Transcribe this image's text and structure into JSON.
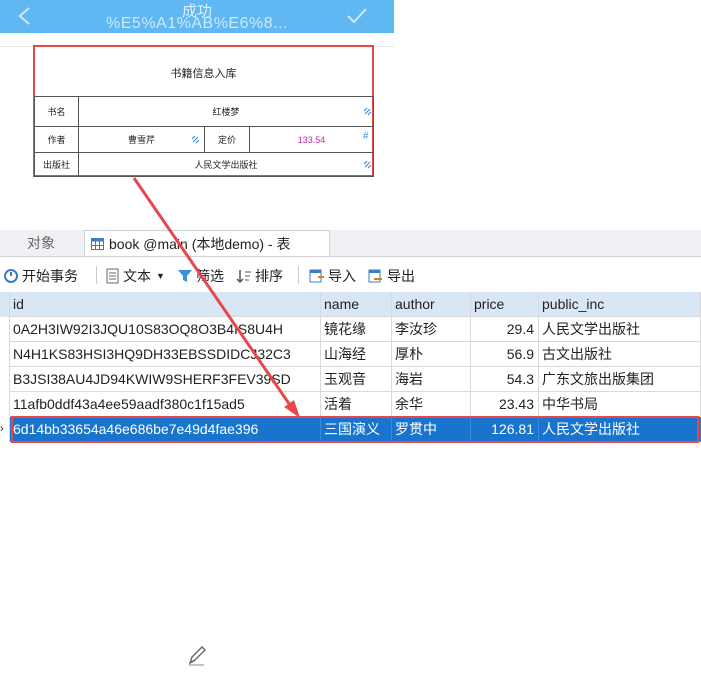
{
  "mobile": {
    "title": "成功",
    "url_text": "%E5%A1%AB%E6%8...",
    "form": {
      "title": "书籍信息入库",
      "name_label": "书名",
      "name_value": "红楼梦",
      "author_label": "作者",
      "author_value": "曹雪芹",
      "price_label": "定价",
      "price_value": "133.54",
      "publisher_label": "出版社",
      "publisher_value": "人民文学出版社"
    }
  },
  "db": {
    "tabs": [
      {
        "label": "对象"
      },
      {
        "label": "book @main (本地demo) - 表"
      }
    ],
    "toolbar": {
      "begin_tx": "开始事务",
      "text": "文本",
      "filter": "筛选",
      "sort": "排序",
      "import": "导入",
      "export": "导出"
    },
    "columns": [
      "id",
      "name",
      "author",
      "price",
      "public_inc"
    ],
    "rows": [
      {
        "id": "0A2H3IW92I3JQU10S83OQ8O3B4IS8U4H",
        "name": "镜花缘",
        "author": "李汝珍",
        "price": "29.4",
        "public_inc": "人民文学出版社"
      },
      {
        "id": "N4H1KS83HSI3HQ9DH33EBSSDIDCJ32C3",
        "name": "山海经",
        "author": "厚朴",
        "price": "56.9",
        "public_inc": "古文出版社"
      },
      {
        "id": "B3JSI38AU4JD94KWIW9SHERF3FEV39SD",
        "name": "玉观音",
        "author": "海岩",
        "price": "54.3",
        "public_inc": "广东文旅出版集团"
      },
      {
        "id": "11afb0ddf43a4ee59aadf380c1f15ad5",
        "name": "活着",
        "author": "余华",
        "price": "23.43",
        "public_inc": "中华书局"
      },
      {
        "id": "6d14bb33654a46e686be7e49d4fae396",
        "name": "三国演义",
        "author": "罗贯中",
        "price": "126.81",
        "public_inc": "人民文学出版社"
      }
    ],
    "selected_row_marker": "›"
  },
  "colors": {
    "header_blue": "#5fb8f2",
    "highlight_red": "#e8474b",
    "selection_blue": "#1874cd",
    "price_magenta": "#c02ac0"
  }
}
